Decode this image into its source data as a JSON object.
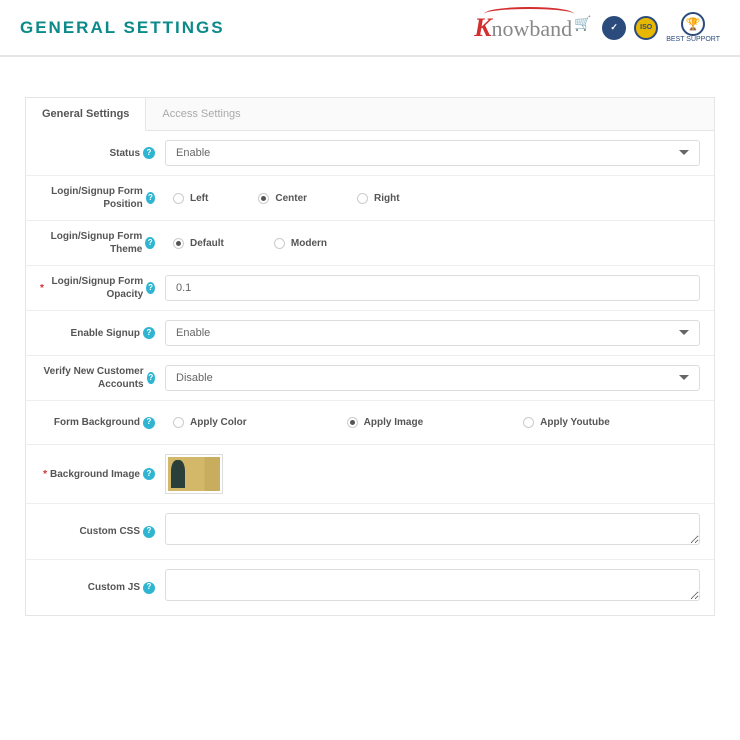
{
  "header": {
    "title": "GENERAL SETTINGS",
    "brand": "nowband",
    "iso_text": "ISO",
    "award_text": "BEST SUPPORT"
  },
  "tabs": [
    {
      "label": "General Settings",
      "active": true
    },
    {
      "label": "Access Settings",
      "active": false
    }
  ],
  "fields": {
    "status": {
      "label": "Status",
      "value": "Enable"
    },
    "position": {
      "label": "Login/Signup Form Position",
      "options": [
        "Left",
        "Center",
        "Right"
      ],
      "selected": "Center"
    },
    "theme": {
      "label": "Login/Signup Form Theme",
      "options": [
        "Default",
        "Modern"
      ],
      "selected": "Default"
    },
    "opacity": {
      "label": "Login/Signup Form Opacity",
      "value": "0.1",
      "required": true
    },
    "enable_signup": {
      "label": "Enable Signup",
      "value": "Enable"
    },
    "verify": {
      "label": "Verify New Customer Accounts",
      "value": "Disable"
    },
    "background": {
      "label": "Form Background",
      "options": [
        "Apply Color",
        "Apply Image",
        "Apply Youtube"
      ],
      "selected": "Apply Image"
    },
    "bg_image": {
      "label": "Background Image",
      "required": true
    },
    "custom_css": {
      "label": "Custom CSS",
      "value": ""
    },
    "custom_js": {
      "label": "Custom JS",
      "value": ""
    }
  }
}
